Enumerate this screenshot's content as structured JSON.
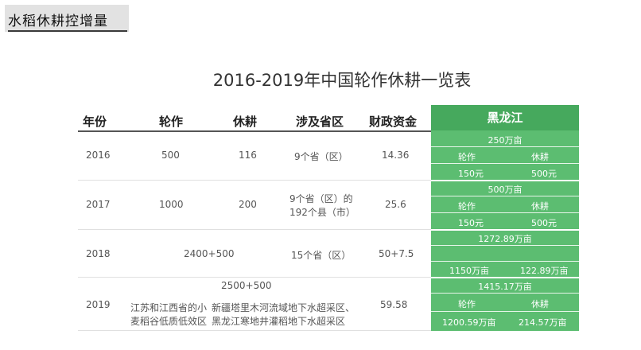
{
  "banner": {
    "title": "水稻休耕控增量"
  },
  "table": {
    "title": "2016-2019年中国轮作休耕一览表",
    "headers": {
      "year": "年份",
      "rotation": "轮作",
      "fallow": "休耕",
      "provinces": "涉及省区",
      "funds": "财政资金",
      "heilongjiang": "黑龙江"
    },
    "rows": [
      {
        "year": "2016",
        "rotation": "500",
        "fallow": "116",
        "provinces": "9个省（区）",
        "funds": "14.36"
      },
      {
        "year": "2017",
        "rotation": "1000",
        "fallow": "200",
        "provinces_line1": "9个省（区）的",
        "provinces_line2": "192个县（市）",
        "funds": "25.6"
      },
      {
        "year": "2018",
        "combined": "2400+500",
        "provinces": "15个省（区）",
        "funds": "50+7.5"
      },
      {
        "year": "2019",
        "combined": "2500+500",
        "rotation_line1": "江苏和江西省的小",
        "rotation_line2": "麦稻谷低质低效区",
        "fallow_line1": "新疆塔里木河流域地下水超采区、",
        "fallow_line2": "黑龙江寒地井灌稻地下水超采区",
        "funds": "59.58"
      }
    ],
    "heilongjiang": [
      {
        "area": "250万亩",
        "rotation_label": "轮作",
        "fallow_label": "休耕",
        "rotation_value": "150元",
        "fallow_value": "500元"
      },
      {
        "area": "500万亩",
        "rotation_label": "轮作",
        "fallow_label": "休耕",
        "rotation_value": "150元",
        "fallow_value": "500元"
      },
      {
        "area": "1272.89万亩",
        "rotation_value": "1150万亩",
        "fallow_value": "122.89万亩"
      },
      {
        "area": "1415.17万亩",
        "rotation_label": "轮作",
        "fallow_label": "休耕",
        "rotation_value": "1200.59万亩",
        "fallow_value": "214.57万亩"
      }
    ]
  }
}
